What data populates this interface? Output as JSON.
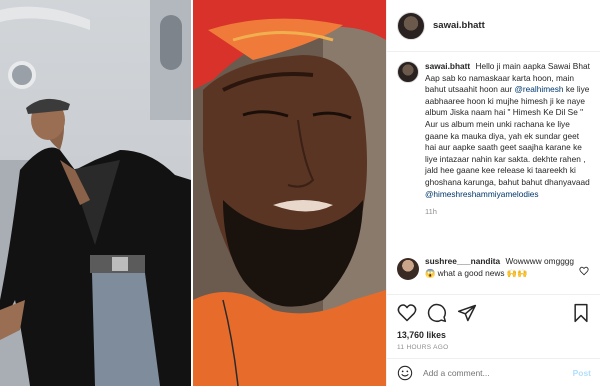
{
  "post": {
    "username": "sawai.bhatt",
    "caption": {
      "username": "sawai.bhatt",
      "text_before_mention": "Hello ji main aapka Sawai Bhat Aap sab ko namaskaar karta hoon, main bahut utsaahit hoon aur",
      "mention_1": "@realhimesh",
      "text_middle": "ke liye aabhaaree hoon ki mujhe himesh ji ke naye album Jiska naam hai \" Himesh Ke Dil Se \" Aur us album mein unki rachana ke liye gaane ka mauka diya, yah ek sundar geet hai aur aapke saath geet saajha karane ke liye intazaar nahin kar sakta. dekhte rahen , jald hee gaane kee release ki taareekh ki ghoshana karunga, bahut bahut dhanyavaad",
      "mention_2": "@himeshreshammiyamelodies",
      "time": "11h"
    },
    "comment": {
      "username": "sushree___nandita",
      "text": "Wowwww omgggg 😱 what a good news 🙌🙌"
    },
    "likes": "13,760 likes",
    "posted_ago": "11 HOURS AGO",
    "add_comment_placeholder": "Add a comment...",
    "post_button": "Post"
  },
  "icons": {
    "like": "heart-icon",
    "comment": "comment-icon",
    "share": "paper-plane-icon",
    "save": "bookmark-icon",
    "emoji": "emoji-icon"
  },
  "colors": {
    "mention": "#00376b",
    "muted": "#8e8e8e",
    "post_button": "#b2dffc",
    "border": "#efefef"
  }
}
